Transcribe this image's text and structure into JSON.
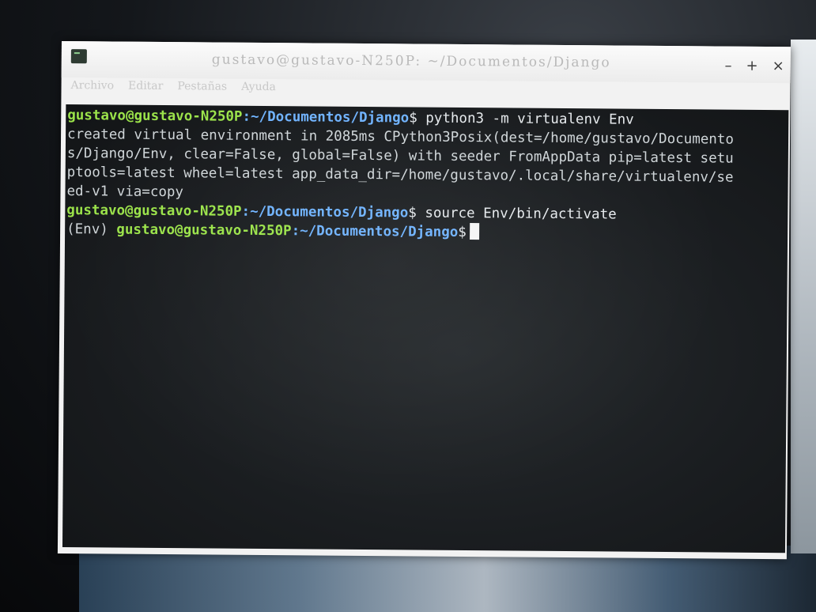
{
  "window": {
    "title": "gustavo@gustavo-N250P: ~/Documentos/Django",
    "controls": {
      "minimize": "–",
      "maximize": "+",
      "close": "×"
    }
  },
  "menubar": {
    "items": [
      {
        "label": "Archivo"
      },
      {
        "label": "Editar"
      },
      {
        "label": "Pestañas"
      },
      {
        "label": "Ayuda"
      }
    ]
  },
  "terminal": {
    "prompt_user": "gustavo@gustavo-N250P",
    "prompt_path": ":~/Documentos/Django",
    "prompt_symbol": "$",
    "venv_prefix": "(Env) ",
    "commands": [
      " python3 -m virtualenv Env",
      " source Env/bin/activate"
    ],
    "output_lines": [
      "created virtual environment in 2085ms CPython3Posix(dest=/home/gustavo/Documento",
      "s/Django/Env, clear=False, global=False) with seeder FromAppData pip=latest setu",
      "ptools=latest wheel=latest app_data_dir=/home/gustavo/.local/share/virtualenv/se",
      "ed-v1 via=copy"
    ]
  },
  "colors": {
    "prompt_user": "#9be34a",
    "prompt_path": "#6fb3ff",
    "terminal_bg": "#1a1d20",
    "text": "#d8dde0"
  }
}
